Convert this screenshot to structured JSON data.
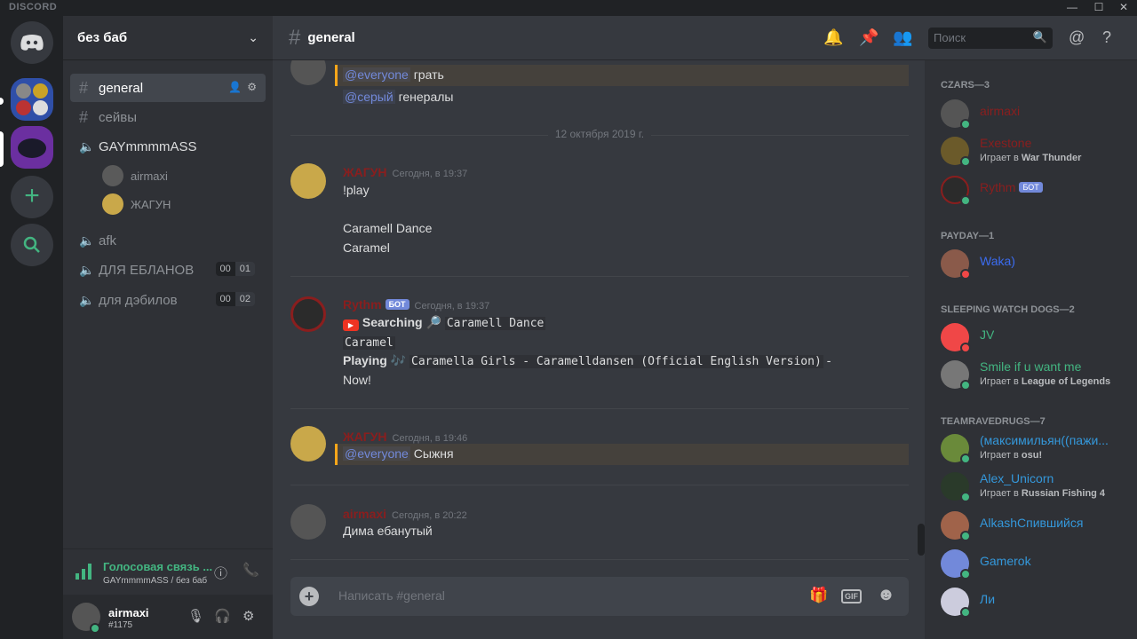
{
  "window": {
    "brand": "DISCORD"
  },
  "guild": {
    "name": "без баб"
  },
  "channels": [
    {
      "name": "general",
      "type": "text"
    },
    {
      "name": "сейвы",
      "type": "text"
    },
    {
      "name": "GAYmmmmASS",
      "type": "voice",
      "users": [
        "airmaxi",
        "ЖАГУН"
      ]
    },
    {
      "name": "afk",
      "type": "voice"
    },
    {
      "name": "ДЛЯ ЕБЛАНОВ",
      "type": "voice",
      "limit": [
        "00",
        "01"
      ]
    },
    {
      "name": "для дэбилов",
      "type": "voice",
      "limit": [
        "00",
        "02"
      ]
    }
  ],
  "voice_panel": {
    "status": "Голосовая связь ...",
    "location": "GAYmmmmASS / без баб"
  },
  "user_panel": {
    "name": "airmaxi",
    "tag": "#1175"
  },
  "chat": {
    "channel": "general",
    "search_placeholder": "Поиск",
    "input_placeholder": "Написать #general",
    "date_divider": "12 октября 2019 г.",
    "messages": [
      {
        "lines": [
          "@everyone",
          "грать"
        ],
        "second": [
          "@серый",
          "генералы"
        ]
      },
      {
        "author": "ЖАГУН",
        "time": "Сегодня, в 19:37",
        "lines": [
          "!play",
          "Caramell Dance",
          "Caramel"
        ]
      },
      {
        "author": "Rythm",
        "bot": "БОТ",
        "time": "Сегодня, в 19:37",
        "searching": "Searching",
        "search_query": "Caramell Dance",
        "query2": "Caramel",
        "playing": "Playing",
        "track": "Caramella Girls - Caramelldansen (Official English Version)",
        "dash": "-",
        "now": "Now!"
      },
      {
        "author": "ЖАГУН",
        "time": "Сегодня, в 19:46",
        "mention": "@everyone",
        "text": "Сыжня"
      },
      {
        "author": "airmaxi",
        "time": "Сегодня, в 20:22",
        "text": "Дима ебанутый"
      }
    ]
  },
  "members": {
    "groups": [
      {
        "title": "CZARS—3",
        "members": [
          {
            "name": "airmaxi",
            "color": "#8a1e1e"
          },
          {
            "name": "Exestone",
            "color": "#8a1e1e",
            "activity_prefix": "Играет в",
            "activity": "War Thunder"
          },
          {
            "name": "Rythm",
            "color": "#8a1e1e",
            "bot": "БОТ"
          }
        ]
      },
      {
        "title": "PAYDAY—1",
        "members": [
          {
            "name": "Waka)",
            "color": "#3b6cf0"
          }
        ]
      },
      {
        "title": "SLEEPING WATCH DOGS—2",
        "members": [
          {
            "name": "JV",
            "color": "#43b581"
          },
          {
            "name": "Smile if u want me",
            "color": "#43b581",
            "activity_prefix": "Играет в",
            "activity": "League of Legends"
          }
        ]
      },
      {
        "title": "TEAMRAVEDRUGS—7",
        "members": [
          {
            "name": "(максимильян((пажи...",
            "color": "#3498db",
            "activity_prefix": "Играет в",
            "activity": "osu!"
          },
          {
            "name": "Alex_Unicorn",
            "color": "#3498db",
            "activity_prefix": "Играет в",
            "activity": "Russian Fishing 4"
          },
          {
            "name": "AlkashСпившийся",
            "color": "#3498db"
          },
          {
            "name": "Gamerok",
            "color": "#3498db"
          },
          {
            "name": "Ли",
            "color": "#3498db"
          }
        ]
      }
    ]
  }
}
